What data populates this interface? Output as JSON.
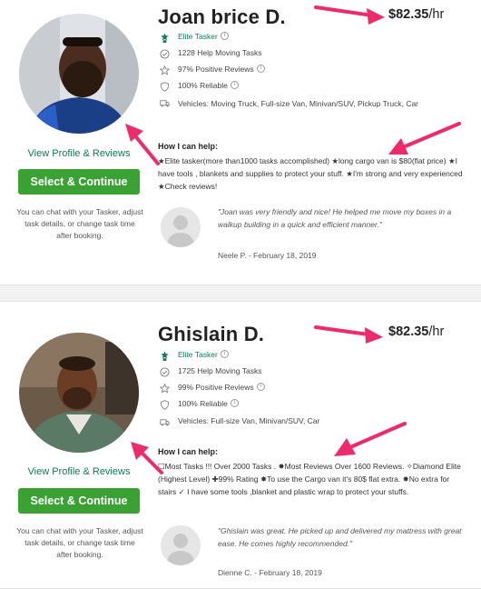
{
  "taskers": [
    {
      "name": "Joan brice D.",
      "rate": "$82.35",
      "rate_unit": "/hr",
      "badge": "Elite Tasker",
      "tasks": "1228 Help Moving Tasks",
      "reviews": "97% Positive Reviews",
      "reliable": "100% Reliable",
      "vehicles": "Vehicles: Moving Truck, Full-size Van, Minivan/SUV, Pickup Truck, Car",
      "view_profile": "View Profile & Reviews",
      "select_label": "Select & Continue",
      "note": "You can chat with your Tasker, adjust task details, or change task time after booking.",
      "help_title": "How I can help:",
      "help_text": "★Elite tasker(more than1000 tasks accomplished) ★long cargo van is $80(flat price) ★I have tools , blankets and supplies to protect your stuff. ★I'm strong and very experienced ★Check reviews!",
      "review_quote": "\"Joan was very friendly and nice! He helped me move my boxes in a walkup building in a quick and efficient manner.\"",
      "review_author": "Neele P. - February 18, 2019"
    },
    {
      "name": "Ghislain D.",
      "rate": "$82.35",
      "rate_unit": "/hr",
      "badge": "Elite Tasker",
      "tasks": "1725 Help Moving Tasks",
      "reviews": "99% Positive Reviews",
      "reliable": "100% Reliable",
      "vehicles": "Vehicles: Full-size Van, Minivan/SUV, Car",
      "view_profile": "View Profile & Reviews",
      "select_label": "Select & Continue",
      "note": "You can chat with your Tasker, adjust task details, or change task time after booking.",
      "help_title": "How I can help:",
      "help_text": "☐Most Tasks !!! Over 2000 Tasks . ✸Most Reviews Over 1600 Reviews. ✧Diamond Elite (Highest Level) ✚99% Rating ✸To use the Cargo van it's 80$ flat extra. ✸No extra for stairs ✓ I have some tools ,blanket and plastic wrap to protect your stuffs.",
      "review_quote": "\"Ghislain was great. He picked up and delivered my mattress with great ease. He comes highly recommended.\"",
      "review_author": "Dienne C. - February 18, 2019"
    }
  ],
  "icons": {
    "badge": "elite-badge-icon",
    "tasks": "check-circle-icon",
    "reviews": "star-icon",
    "reliable": "shield-icon",
    "vehicles": "truck-icon",
    "info": "info-icon"
  },
  "colors": {
    "accent_green": "#3aa133",
    "link_green": "#0d7a52",
    "arrow_pink": "#ee2a6b"
  }
}
